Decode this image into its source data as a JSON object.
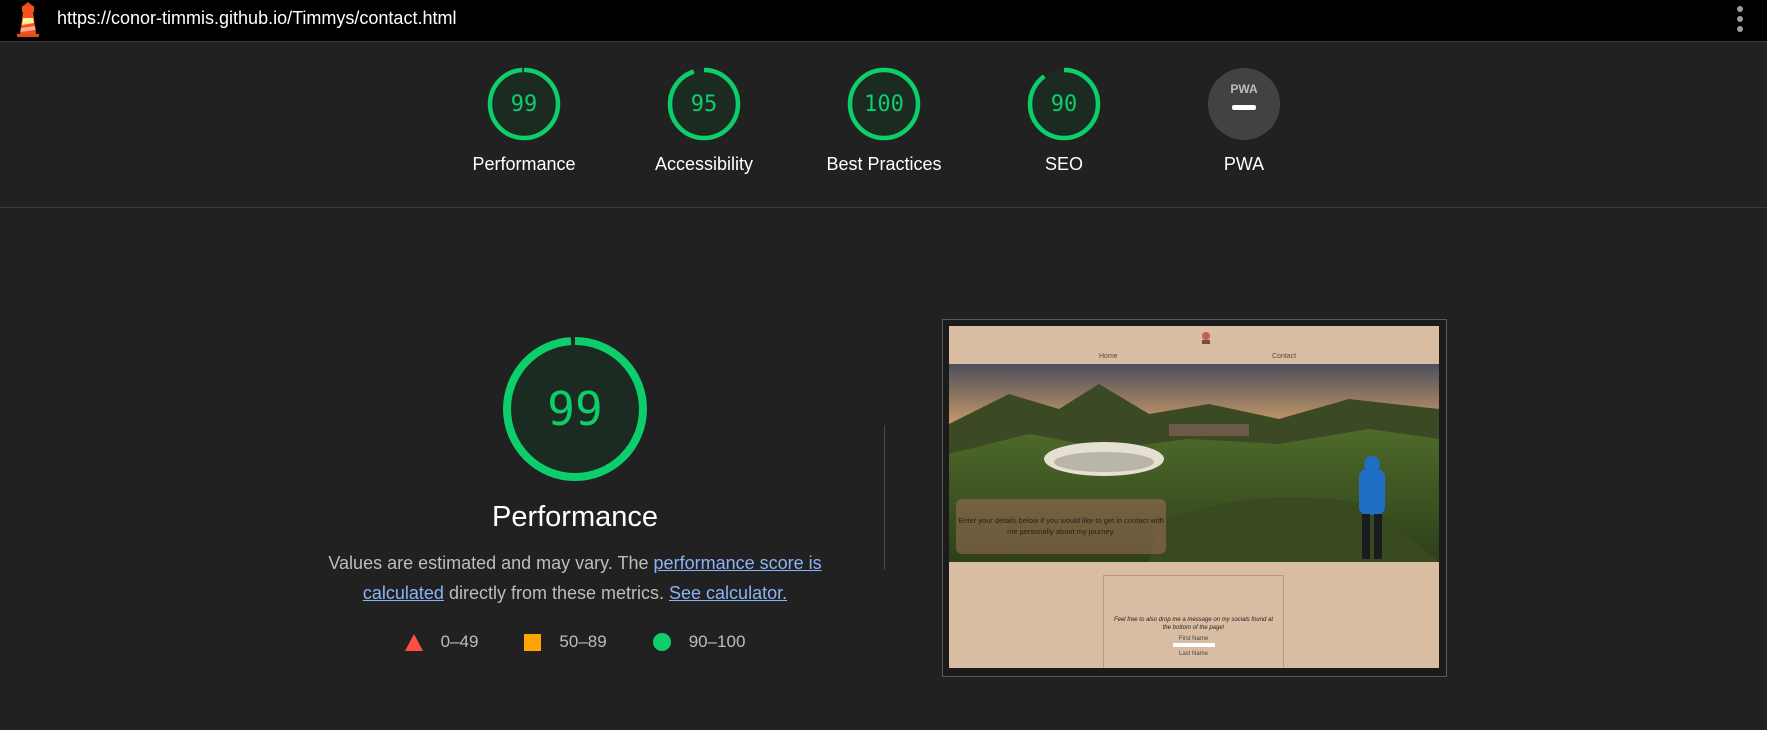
{
  "url": "https://conor-timmis.github.io/Timmys/contact.html",
  "colors": {
    "pass": "#0cce6b",
    "average": "#ffa400",
    "fail": "#ff4e42",
    "background": "#212121"
  },
  "gauges": [
    {
      "score": "99",
      "label": "Performance",
      "value": 0.99
    },
    {
      "score": "95",
      "label": "Accessibility",
      "value": 0.95
    },
    {
      "score": "100",
      "label": "Best Practices",
      "value": 1.0
    },
    {
      "score": "90",
      "label": "SEO",
      "value": 0.9
    },
    {
      "badge": "PWA",
      "label": "PWA"
    }
  ],
  "main": {
    "score": "99",
    "value": 0.99,
    "title": "Performance",
    "desc_pre": "Values are estimated and may vary. The ",
    "link_score": "performance score is calculated",
    "desc_mid": " directly from these metrics. ",
    "link_calc": "See calculator.",
    "legend": [
      {
        "icon": "triangle-icon",
        "range": "0–49"
      },
      {
        "icon": "square-icon",
        "range": "50–89"
      },
      {
        "icon": "circle-icon",
        "range": "90–100"
      }
    ]
  },
  "screenshot": {
    "nav_home": "Home",
    "nav_contact": "Contact",
    "overlay_text": "Enter your details below if you would like to get in contact with me personally about my journey.",
    "form_note": "Feel free to also drop me a message on my socials found at the bottom of the page!",
    "first_name": "First Name",
    "last_name": "Last Name"
  }
}
